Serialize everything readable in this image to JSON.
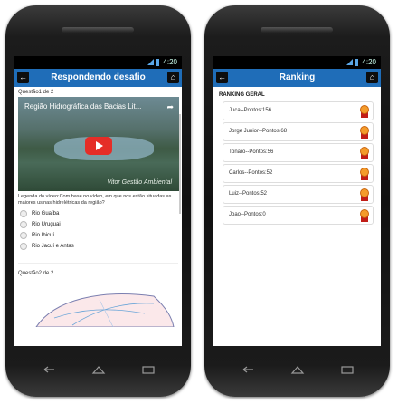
{
  "left_phone": {
    "status": {
      "time": "4:20"
    },
    "appbar": {
      "title": "Respondendo desafio"
    },
    "question1": {
      "label": "Questão1 de 2"
    },
    "video": {
      "title": "Região Hidrográfica das Bacias Lit...",
      "credit": "Vitor Gestão Ambiental"
    },
    "caption": "Legenda do vídeo:Com base no vídeo, em que nos estão situadas as maiores usinas hidrelétricas da região?",
    "options": [
      "Rio Guaíba",
      "Rio Uruguai",
      "Rio Ibicuí",
      "Rio Jacuí e Antas"
    ],
    "question2": {
      "label": "Questão2 de 2"
    }
  },
  "right_phone": {
    "status": {
      "time": "4:20"
    },
    "appbar": {
      "title": "Ranking"
    },
    "section_title": "RANKING GERAL",
    "items": [
      {
        "label": "Juca--Pontos:156"
      },
      {
        "label": "Jorge Junior--Pontos:68"
      },
      {
        "label": "Tonaro--Pontos:56"
      },
      {
        "label": "Carlos--Pontos:52"
      },
      {
        "label": "Luiz--Pontos:52"
      },
      {
        "label": "Joao--Pontos:0"
      }
    ]
  },
  "colors": {
    "appbar": "#1f6db8",
    "play_button": "#e52d27",
    "medal": "#f49b2a"
  }
}
